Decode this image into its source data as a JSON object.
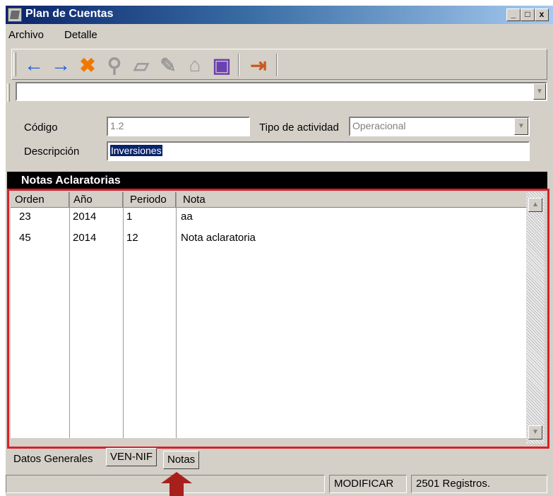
{
  "window": {
    "title": "Plan de Cuentas",
    "controls": {
      "minimize": "_",
      "maximize": "□",
      "close": "x"
    }
  },
  "menu": {
    "items": [
      "Archivo",
      "Detalle"
    ]
  },
  "toolbar": {
    "buttons": [
      {
        "icon": "arrow-left-icon",
        "glyph": "🡐",
        "color": "#1f5fd6"
      },
      {
        "icon": "arrow-right-icon",
        "glyph": "🡒",
        "color": "#1f5fd6"
      },
      {
        "icon": "delete-x-icon",
        "glyph": "✖",
        "color": "#f07800"
      },
      {
        "icon": "search-icon",
        "glyph": "⚲",
        "color": "#9a9a9a"
      },
      {
        "icon": "open-folder-icon",
        "glyph": "▱",
        "color": "#9a9a9a"
      },
      {
        "icon": "edit-icon",
        "glyph": "✎",
        "color": "#9a9a9a"
      },
      {
        "icon": "trash-icon",
        "glyph": "⌂",
        "color": "#9a9a9a"
      },
      {
        "icon": "save-icon",
        "glyph": "▣",
        "color": "#6b40b0"
      },
      {
        "icon": "exit-door-icon",
        "glyph": "⇥",
        "color": "#c85a1e"
      }
    ]
  },
  "form": {
    "codigo_label": "Código",
    "codigo_value": "1.2",
    "tipo_label": "Tipo de actividad",
    "tipo_value": "Operacional",
    "descripcion_label": "Descripción",
    "descripcion_value": "Inversiones"
  },
  "notes": {
    "header": "Notas Aclaratorias",
    "columns": [
      "Orden",
      "Año",
      "Periodo",
      "Nota"
    ],
    "rows": [
      {
        "orden": "23",
        "anio": "2014",
        "periodo": "1",
        "nota": "aa"
      },
      {
        "orden": "45",
        "anio": "2014",
        "periodo": "12",
        "nota": "Nota aclaratoria"
      }
    ]
  },
  "tabs": [
    "Datos Generales",
    "VEN-NIF",
    "Notas"
  ],
  "status": {
    "mode": "MODIFICAR",
    "records": "2501 Registros."
  },
  "colors": {
    "highlight_box": "#d9202c",
    "selection": "#0a246a"
  }
}
